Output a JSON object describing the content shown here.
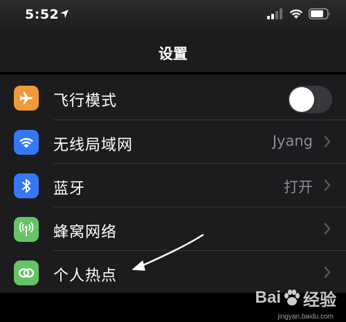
{
  "status_bar": {
    "time": "5:52"
  },
  "nav": {
    "title": "设置"
  },
  "settings": [
    {
      "label": "飞行模式",
      "value": "",
      "icon": "airplane-icon",
      "icon_color": "#f09a37",
      "type": "toggle",
      "toggle_on": false
    },
    {
      "label": "无线局域网",
      "value": "Jyang",
      "icon": "wifi-icon",
      "icon_color": "#3478f6",
      "type": "disclosure"
    },
    {
      "label": "蓝牙",
      "value": "打开",
      "icon": "bluetooth-icon",
      "icon_color": "#3478f6",
      "type": "disclosure"
    },
    {
      "label": "蜂窝网络",
      "value": "",
      "icon": "antenna-icon",
      "icon_color": "#65c466",
      "type": "disclosure"
    },
    {
      "label": "个人热点",
      "value": "",
      "icon": "hotspot-icon",
      "icon_color": "#65c466",
      "type": "disclosure"
    }
  ],
  "watermark": {
    "brand_left": "Bai",
    "brand_right": "经验",
    "url": "jingyan.baidu.com"
  }
}
